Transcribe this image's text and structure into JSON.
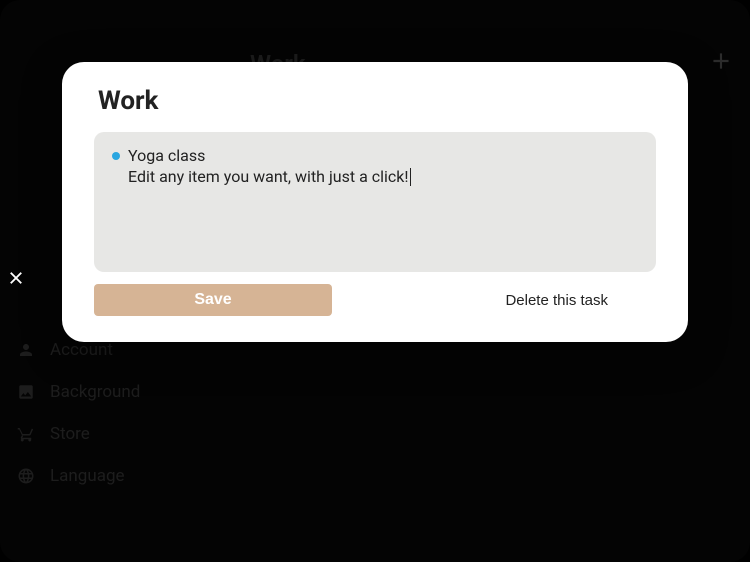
{
  "modal": {
    "title": "Work",
    "task_text": "Yoga class",
    "hint_text": "Edit any item you want, with just a click!",
    "save_label": "Save",
    "delete_label": "Delete this task"
  },
  "bg": {
    "header_title": "Work",
    "sidebar": {
      "items": [
        {
          "label": "Account"
        },
        {
          "label": "Background"
        },
        {
          "label": "Store"
        },
        {
          "label": "Language"
        }
      ]
    }
  },
  "colors": {
    "accent_bullet": "#2aa6e0",
    "save_button": "#d6b495"
  }
}
